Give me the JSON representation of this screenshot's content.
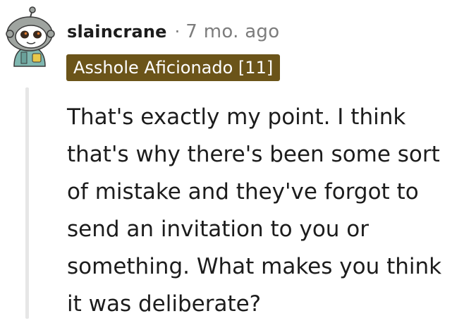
{
  "comment": {
    "author": "slaincrane",
    "separator": "·",
    "time_ago": "7 mo. ago",
    "flair": "Asshole Aficionado [11]",
    "body_lines": [
      "That's exactly my point. I think",
      "that's why there's been some sort",
      "of mistake and they've forgot to",
      "send an invitation to you or",
      "something. What makes you think",
      "it was deliberate?"
    ]
  },
  "colors": {
    "flair_background": "#6b5419",
    "flair_text": "#ffffff",
    "username": "#1c1c1c",
    "meta_text": "#7c7c7c",
    "thread_line": "#e6e6e6",
    "avatar_body": "#9fa4a0",
    "avatar_face": "#ffffff",
    "avatar_eye": "#3a2a1e",
    "avatar_accent": "#e07a2e",
    "avatar_hoodie_teal": "#7fb7b0"
  },
  "icons": {
    "avatar": "snoo-avatar-icon"
  }
}
